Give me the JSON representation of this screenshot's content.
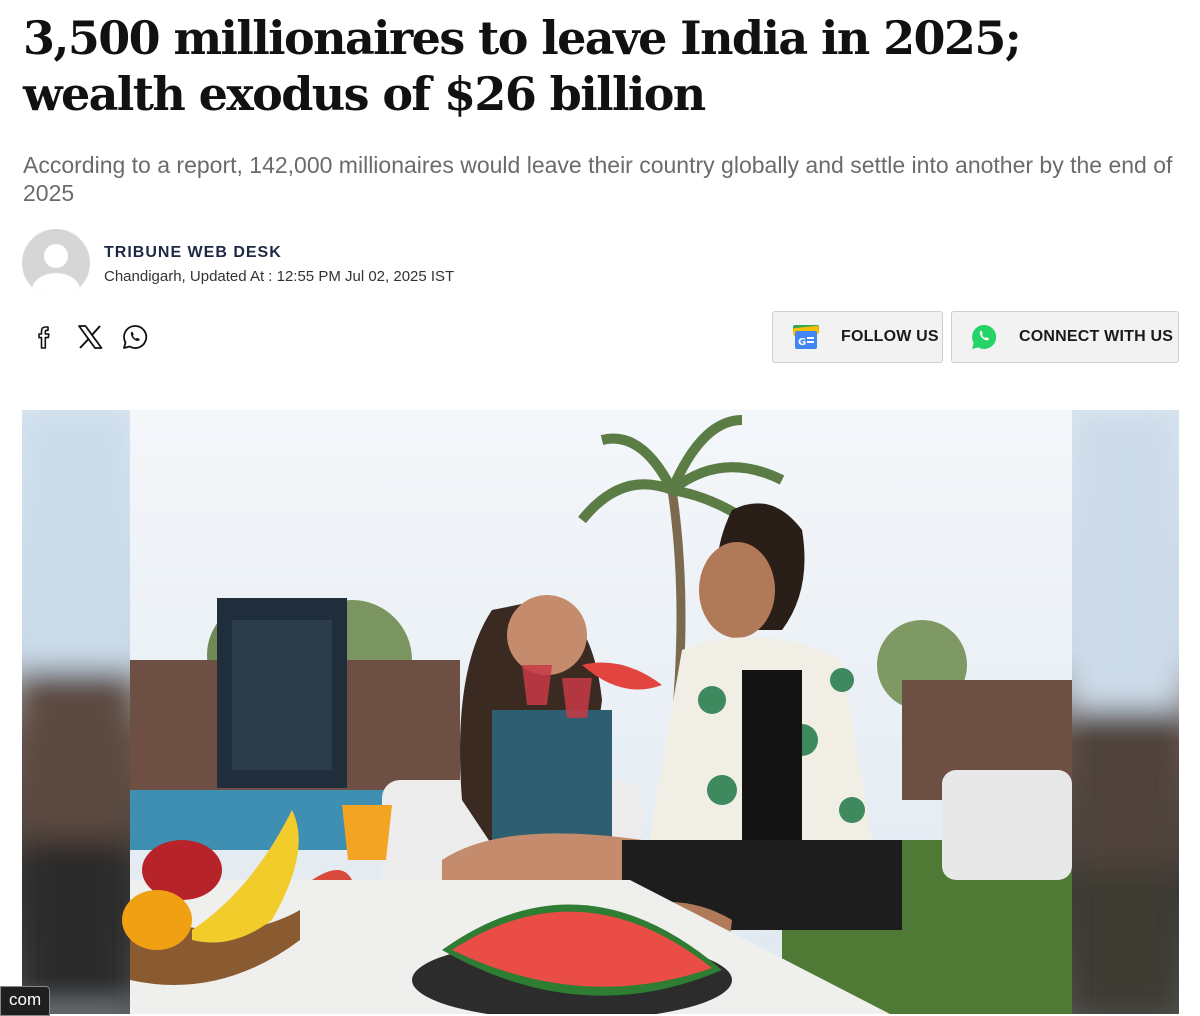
{
  "article": {
    "headline": "3,500 millionaires to leave India in 2025; wealth exodus of $26 billion",
    "subheadline": "According to a report, 142,000 millionaires would leave their country globally and settle into another by the end of 2025",
    "author": "TRIBUNE WEB DESK",
    "dateline": "Chandigarh, Updated At : 12:55 PM Jul 02, 2025 IST"
  },
  "share": {
    "icons": [
      "facebook-icon",
      "x-icon",
      "whatsapp-icon"
    ]
  },
  "actions": {
    "follow_label": "FOLLOW US",
    "connect_label": "CONNECT WITH US"
  },
  "overlay": {
    "corner_text": "com"
  },
  "colors": {
    "headline": "#111111",
    "subhead": "#6b6b6b",
    "author": "#1e2a44",
    "whatsapp": "#25d366",
    "google_news_blue": "#4285f4"
  }
}
